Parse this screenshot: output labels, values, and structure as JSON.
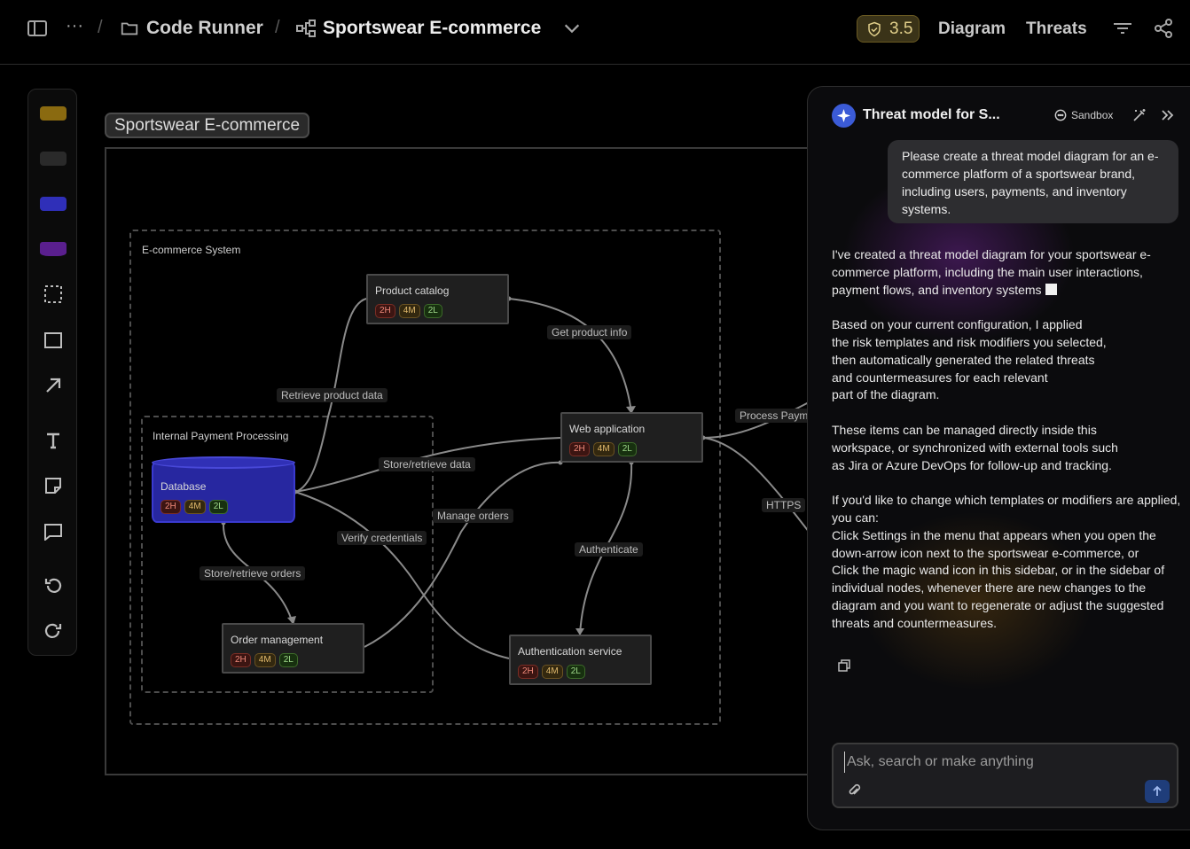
{
  "header": {
    "breadcrumb_ellipsis": "···",
    "separator": "/",
    "project": "Code Runner",
    "diagram": "Sportswear E-commerce",
    "score": "3.5",
    "diagram_link": "Diagram",
    "threats_link": "Threats"
  },
  "toolbar": {
    "colors": [
      "#8a6a10",
      "#2a2a2a",
      "#2f2fb8",
      "#5a1f8e"
    ],
    "tools": [
      "boundary-tool-icon",
      "rectangle-tool-icon",
      "arrow-tool-icon",
      "text-tool-icon",
      "sticky-note-icon",
      "comment-icon",
      "undo-icon",
      "redo-icon"
    ]
  },
  "canvas": {
    "title": "Sportswear E-commerce",
    "boundaries": {
      "ecommerce": "E-commerce System",
      "payment": "Internal Payment Processing"
    },
    "nodes": {
      "product_catalog": {
        "label": "Product catalog",
        "high": "2H",
        "medium": "4M",
        "low": "2L"
      },
      "web_app": {
        "label": "Web  application",
        "high": "2H",
        "medium": "4M",
        "low": "2L"
      },
      "database": {
        "label": "Database",
        "high": "2H",
        "medium": "4M",
        "low": "2L"
      },
      "order_mgmt": {
        "label": "Order management",
        "high": "2H",
        "medium": "4M",
        "low": "2L"
      },
      "auth_service": {
        "label": "Authentication service",
        "high": "2H",
        "medium": "4M",
        "low": "2L"
      }
    },
    "edges": {
      "get_product_info": "Get product info",
      "retrieve_product_data": "Retrieve product data",
      "store_retrieve_data": "Store/retrieve data",
      "manage_orders": "Manage orders",
      "verify_credentials": "Verify credentials",
      "store_retrieve_orders": "Store/retrieve orders",
      "authenticate": "Authenticate",
      "process_payment": "Process Paym",
      "https": "HTTPS"
    }
  },
  "chat": {
    "title": "Threat model for S...",
    "sandbox": "Sandbox",
    "user_message": "Please create a threat model diagram for an e-commerce platform of a sportswear brand, including users, payments, and inventory systems.",
    "reply_1": "I've created a threat model diagram for your sportswear e-commerce platform, including the main user interactions, payment flows, and inventory systems",
    "reply_2": "Based on your current configuration, I applied\nthe risk templates and risk modifiers you selected,\nthen automatically generated the related threats\nand countermeasures for each relevant\npart of the diagram.",
    "reply_3": "These items can be managed directly inside this\nworkspace, or synchronized with external tools such\nas Jira or Azure DevOps for follow-up and tracking.",
    "reply_4": "If you'd like to change which templates or modifiers are applied, you can:\nClick Settings in the menu that appears when you open the down-arrow icon next to the sportswear e-commerce, or\nClick the magic wand icon in this sidebar, or in the sidebar of individual nodes, whenever there are new changes to the diagram and you want to regenerate or adjust the suggested threats and countermeasures.",
    "input_placeholder": "Ask, search or make anything"
  }
}
